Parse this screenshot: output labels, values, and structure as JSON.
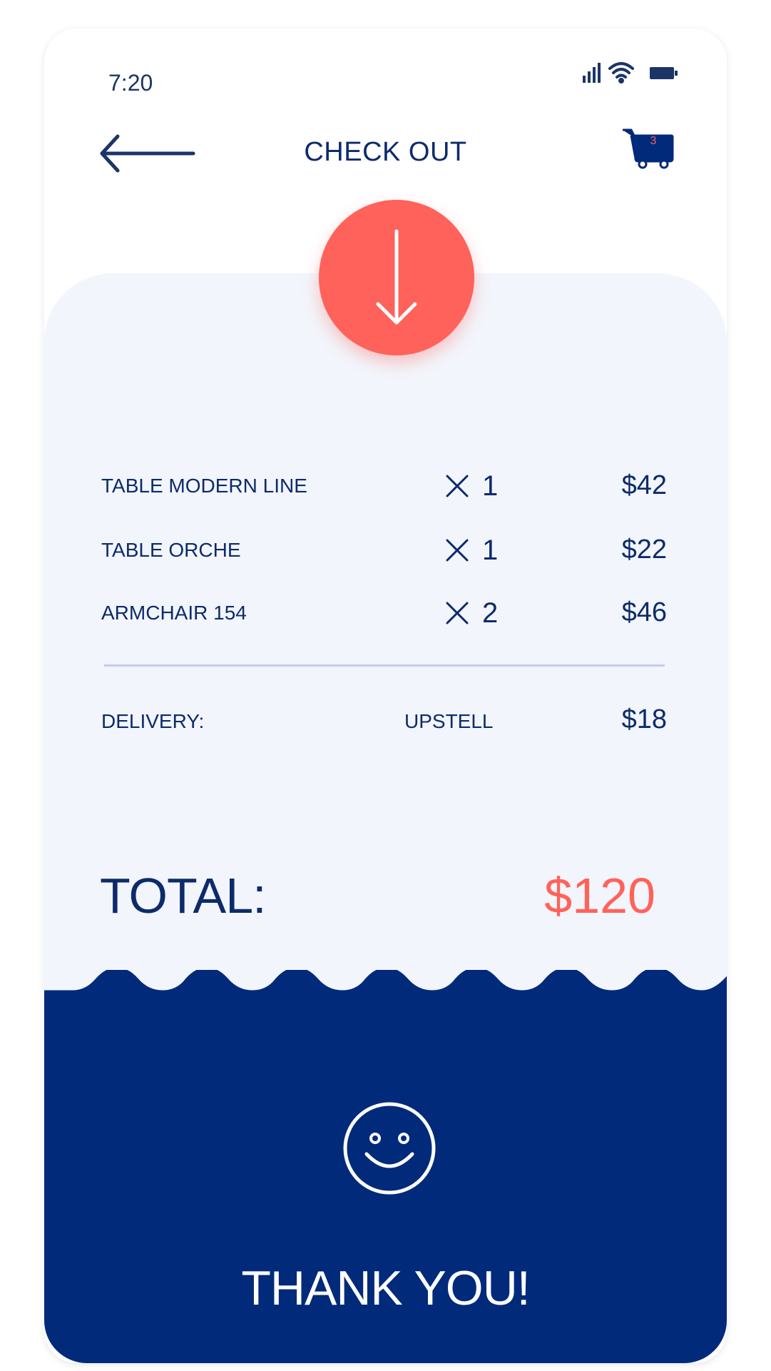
{
  "status_bar": {
    "time": "7:20",
    "icons": [
      "signal-icon",
      "wifi-icon",
      "battery-icon"
    ]
  },
  "header": {
    "title": "CHECK OUT",
    "back_icon": "arrow-left-icon",
    "cart_icon": "cart-icon",
    "cart_count": "3"
  },
  "download_icon": "arrow-down-icon",
  "items": [
    {
      "name": "TABLE MODERN LINE",
      "qty": "1",
      "price": "$42"
    },
    {
      "name": "TABLE ORCHE",
      "qty": "1",
      "price": "$22"
    },
    {
      "name": "ARMCHAIR 154",
      "qty": "2",
      "price": "$46"
    }
  ],
  "delivery": {
    "label": "DELIVERY:",
    "method": "UPSTELL",
    "price": "$18"
  },
  "total": {
    "label": "TOTAL:",
    "value": "$120"
  },
  "footer": {
    "icon": "smiley-icon",
    "message": "THANK YOU!"
  },
  "colors": {
    "navy": "#022a7a",
    "text": "#0d2b6b",
    "accent": "#ff625a",
    "card_bg": "#f2f5fb",
    "divider": "#c4cbef"
  }
}
